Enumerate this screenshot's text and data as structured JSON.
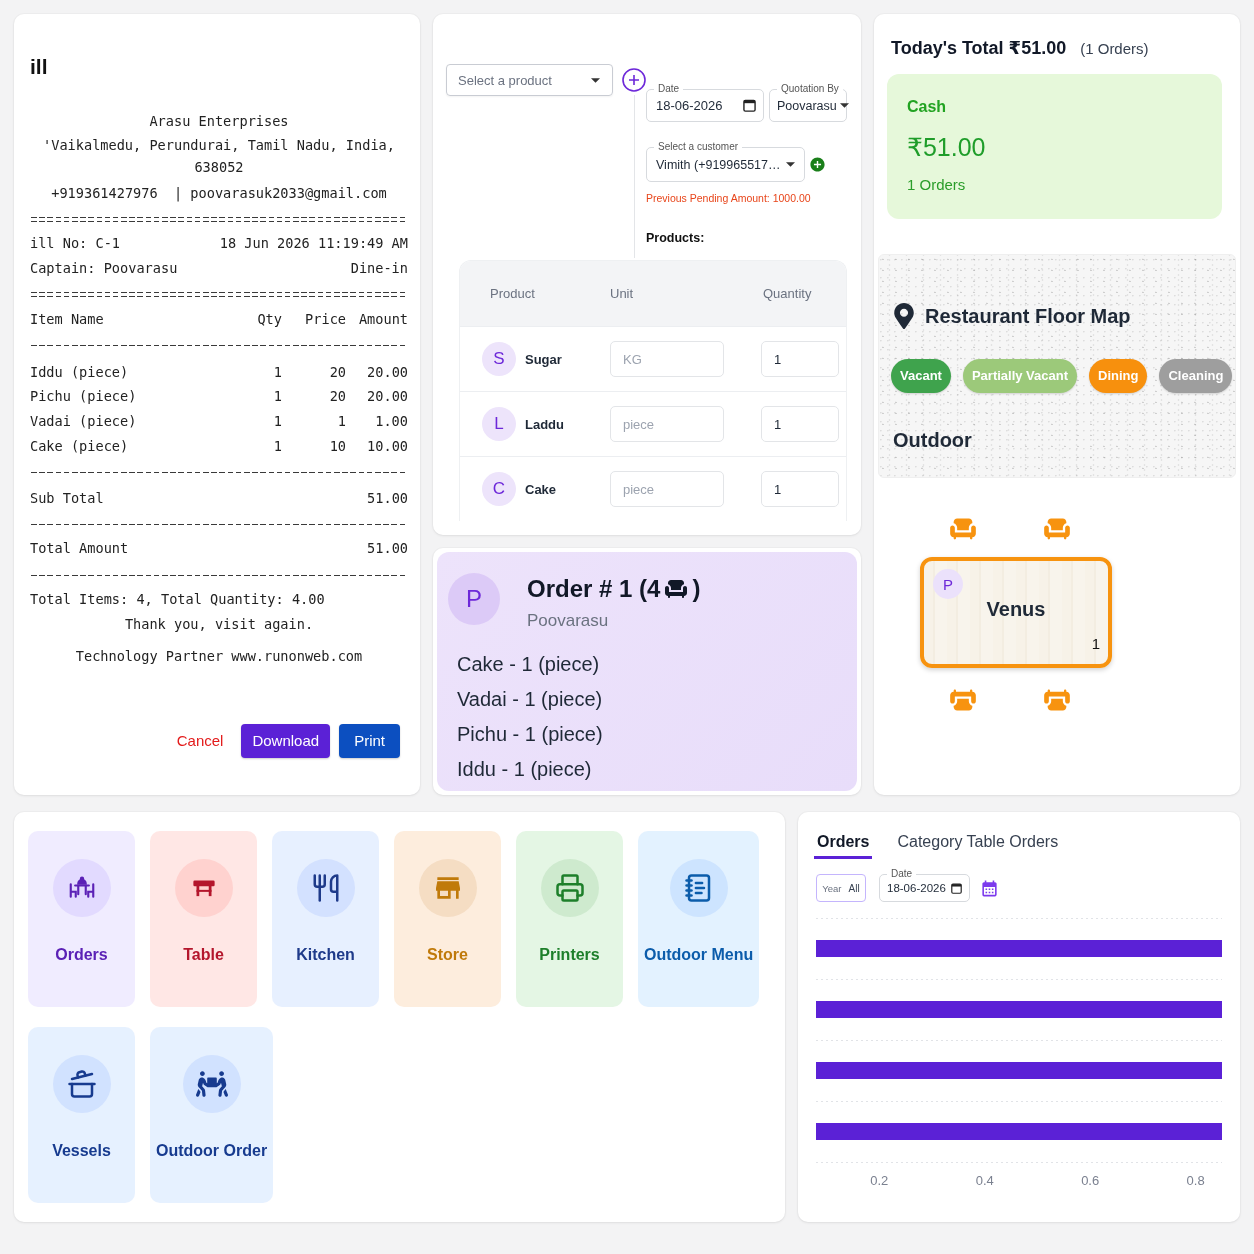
{
  "bill": {
    "title": "ill",
    "receipt": {
      "business": "Arasu Enterprises",
      "address": "'Vaikalmedu, Perundurai, Tamil Nadu, India, 638052",
      "contact": "+919361427976  | poovarasuk2033@gmail.com",
      "bill_no": "ill No: C-1",
      "datetime": "18 Jun 2026 11:19:49 AM",
      "captain": "Captain: Poovarasu",
      "order_type": "Dine-in",
      "columns": [
        "Item Name",
        "Qty",
        "Price",
        "Amount"
      ],
      "items": [
        {
          "name": "Iddu (piece)",
          "qty": "1",
          "price": "20",
          "amount": "20.00"
        },
        {
          "name": "Pichu (piece)",
          "qty": "1",
          "price": "20",
          "amount": "20.00"
        },
        {
          "name": "Vadai (piece)",
          "qty": "1",
          "price": "1",
          "amount": "1.00"
        },
        {
          "name": "Cake (piece)",
          "qty": "1",
          "price": "10",
          "amount": "10.00"
        }
      ],
      "subtotal": {
        "label": "Sub Total",
        "value": "51.00"
      },
      "total": {
        "label": "Total Amount",
        "value": "51.00"
      },
      "summary": "Total Items: 4, Total Quantity: 4.00",
      "thanks": "Thank you, visit again.",
      "partner": "Technology Partner www.runonweb.com"
    },
    "buttons": [
      {
        "label": "Cancel",
        "kind": "text"
      },
      {
        "label": "Download",
        "kind": "primary"
      },
      {
        "label": "Print",
        "kind": "secondary"
      }
    ]
  },
  "quotation": {
    "product_select": {
      "placeholder": "Select a product"
    },
    "date": {
      "label": "Date",
      "value": "18-06-2026"
    },
    "quotation_by": {
      "label": "Quotation By",
      "value": "Poovarasu"
    },
    "customer": {
      "label": "Select a customer",
      "value": "Vimith (+919965517…"
    },
    "pending_amount": "Previous Pending Amount: 1000.00",
    "products_heading": "Products:",
    "table": {
      "columns": [
        "Product",
        "Unit",
        "Quantity"
      ],
      "rows": [
        {
          "initial": "S",
          "name": "Sugar",
          "unit": "KG",
          "quantity": "1"
        },
        {
          "initial": "L",
          "name": "Laddu",
          "unit": "piece",
          "quantity": "1"
        },
        {
          "initial": "C",
          "name": "Cake",
          "unit": "piece",
          "quantity": "1"
        }
      ]
    }
  },
  "order": {
    "initial": "P",
    "title": "Order # 1 (4",
    "title_end": ")",
    "captain": "Poovarasu",
    "items": [
      "Cake - 1 (piece)",
      "Vadai - 1 (piece)",
      "Pichu - 1 (piece)",
      "Iddu - 1 (piece)"
    ]
  },
  "summary": {
    "title": "Today's Total ₹51.00",
    "orders": "(1 Orders)",
    "cards": [
      {
        "label": "Cash",
        "amount": "₹51.00",
        "orders": "1 Orders"
      }
    ]
  },
  "floor_map": {
    "title": "Restaurant Floor Map",
    "legend": [
      {
        "label": "Vacant",
        "color": "#3fa34d"
      },
      {
        "label": "Partially Vacant",
        "color": "#9cc97a"
      },
      {
        "label": "Dining",
        "color": "#f7900d"
      },
      {
        "label": "Cleaning",
        "color": "#9e9e9e"
      }
    ],
    "area": "Outdoor",
    "tables": [
      {
        "name": "Venus",
        "initial": "P",
        "count": "1",
        "color": "#f7930f"
      }
    ]
  },
  "shortcuts": [
    {
      "label": "Orders",
      "kind": "orders",
      "color": "#5b21b6"
    },
    {
      "label": "Table",
      "kind": "table",
      "color": "#b4162c"
    },
    {
      "label": "Kitchen",
      "kind": "kitchen",
      "color": "#1e3a8a"
    },
    {
      "label": "Store",
      "kind": "store",
      "color": "#c07a0a"
    },
    {
      "label": "Printers",
      "kind": "printers",
      "color": "#1d7f2a"
    },
    {
      "label": "Outdoor Menu",
      "kind": "menu",
      "color": "#0b5cab"
    },
    {
      "label": "Vessels",
      "kind": "vessels",
      "color": "#173b8f"
    },
    {
      "label": "Outdoor Order",
      "kind": "delivery",
      "color": "#173b8f"
    }
  ],
  "reports": {
    "tabs": [
      {
        "label": "Orders",
        "selected": true
      },
      {
        "label": "Category Table Orders",
        "selected": false
      }
    ],
    "year_filter": {
      "label": "Year",
      "value": "All"
    },
    "date": {
      "label": "Date",
      "value": "18-06-2026"
    },
    "chart_data": {
      "type": "bar",
      "orientation": "horizontal",
      "xlim": [
        0.08,
        0.85
      ],
      "xticks": [
        0.2,
        0.4,
        0.6,
        0.8
      ],
      "series": [
        {
          "color": "#5b21d6",
          "values": [
            0.85,
            0.85,
            0.85,
            0.85
          ]
        }
      ]
    }
  }
}
